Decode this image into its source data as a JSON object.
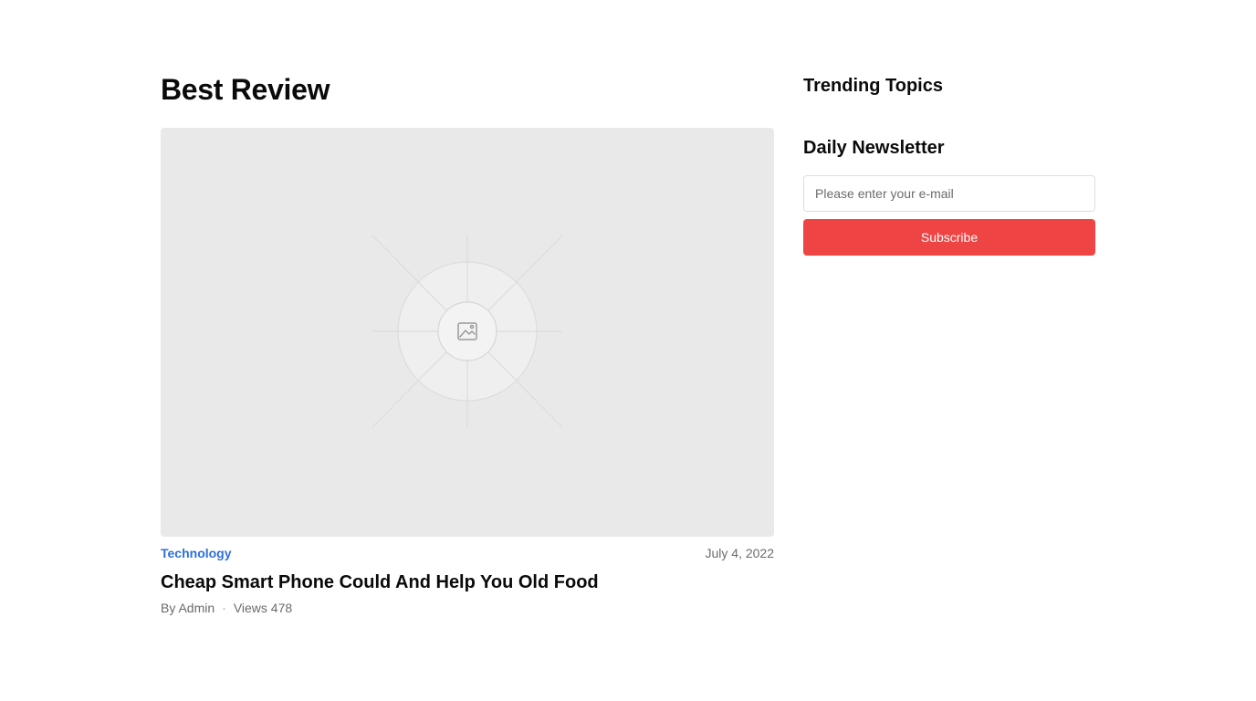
{
  "main": {
    "section_title": "Best Review",
    "post": {
      "category": "Technology",
      "date": "July 4, 2022",
      "title": "Cheap Smart Phone Could And Help You Old Food",
      "author": "By Admin",
      "separator": "·",
      "views": "Views 478",
      "image_icon": "image-placeholder-icon"
    }
  },
  "sidebar": {
    "trending_title": "Trending Topics",
    "newsletter": {
      "title": "Daily Newsletter",
      "email_placeholder": "Please enter your e-mail",
      "email_value": "",
      "subscribe_label": "Subscribe"
    }
  },
  "colors": {
    "accent": "#ef4444",
    "category": "#2f6fdb",
    "muted_text": "#6b6b6b",
    "placeholder_bg": "#e9e9e9"
  }
}
